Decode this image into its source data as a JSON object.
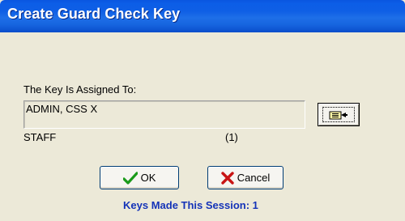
{
  "window": {
    "title": "Create Guard Check Key"
  },
  "assigned": {
    "label": "The Key Is Assigned To:",
    "value": "ADMIN, CSS X",
    "category": "STAFF",
    "count": "(1)"
  },
  "buttons": {
    "ok": "OK",
    "cancel": "Cancel"
  },
  "status": {
    "text": "Keys Made This Session: 1"
  },
  "icons": {
    "pick": "pointing-hand-icon",
    "ok": "green-check-icon",
    "cancel": "red-x-icon"
  },
  "colors": {
    "titlebar": "#0a56e0",
    "status_text": "#1433b8",
    "window_bg": "#ece9d8"
  }
}
